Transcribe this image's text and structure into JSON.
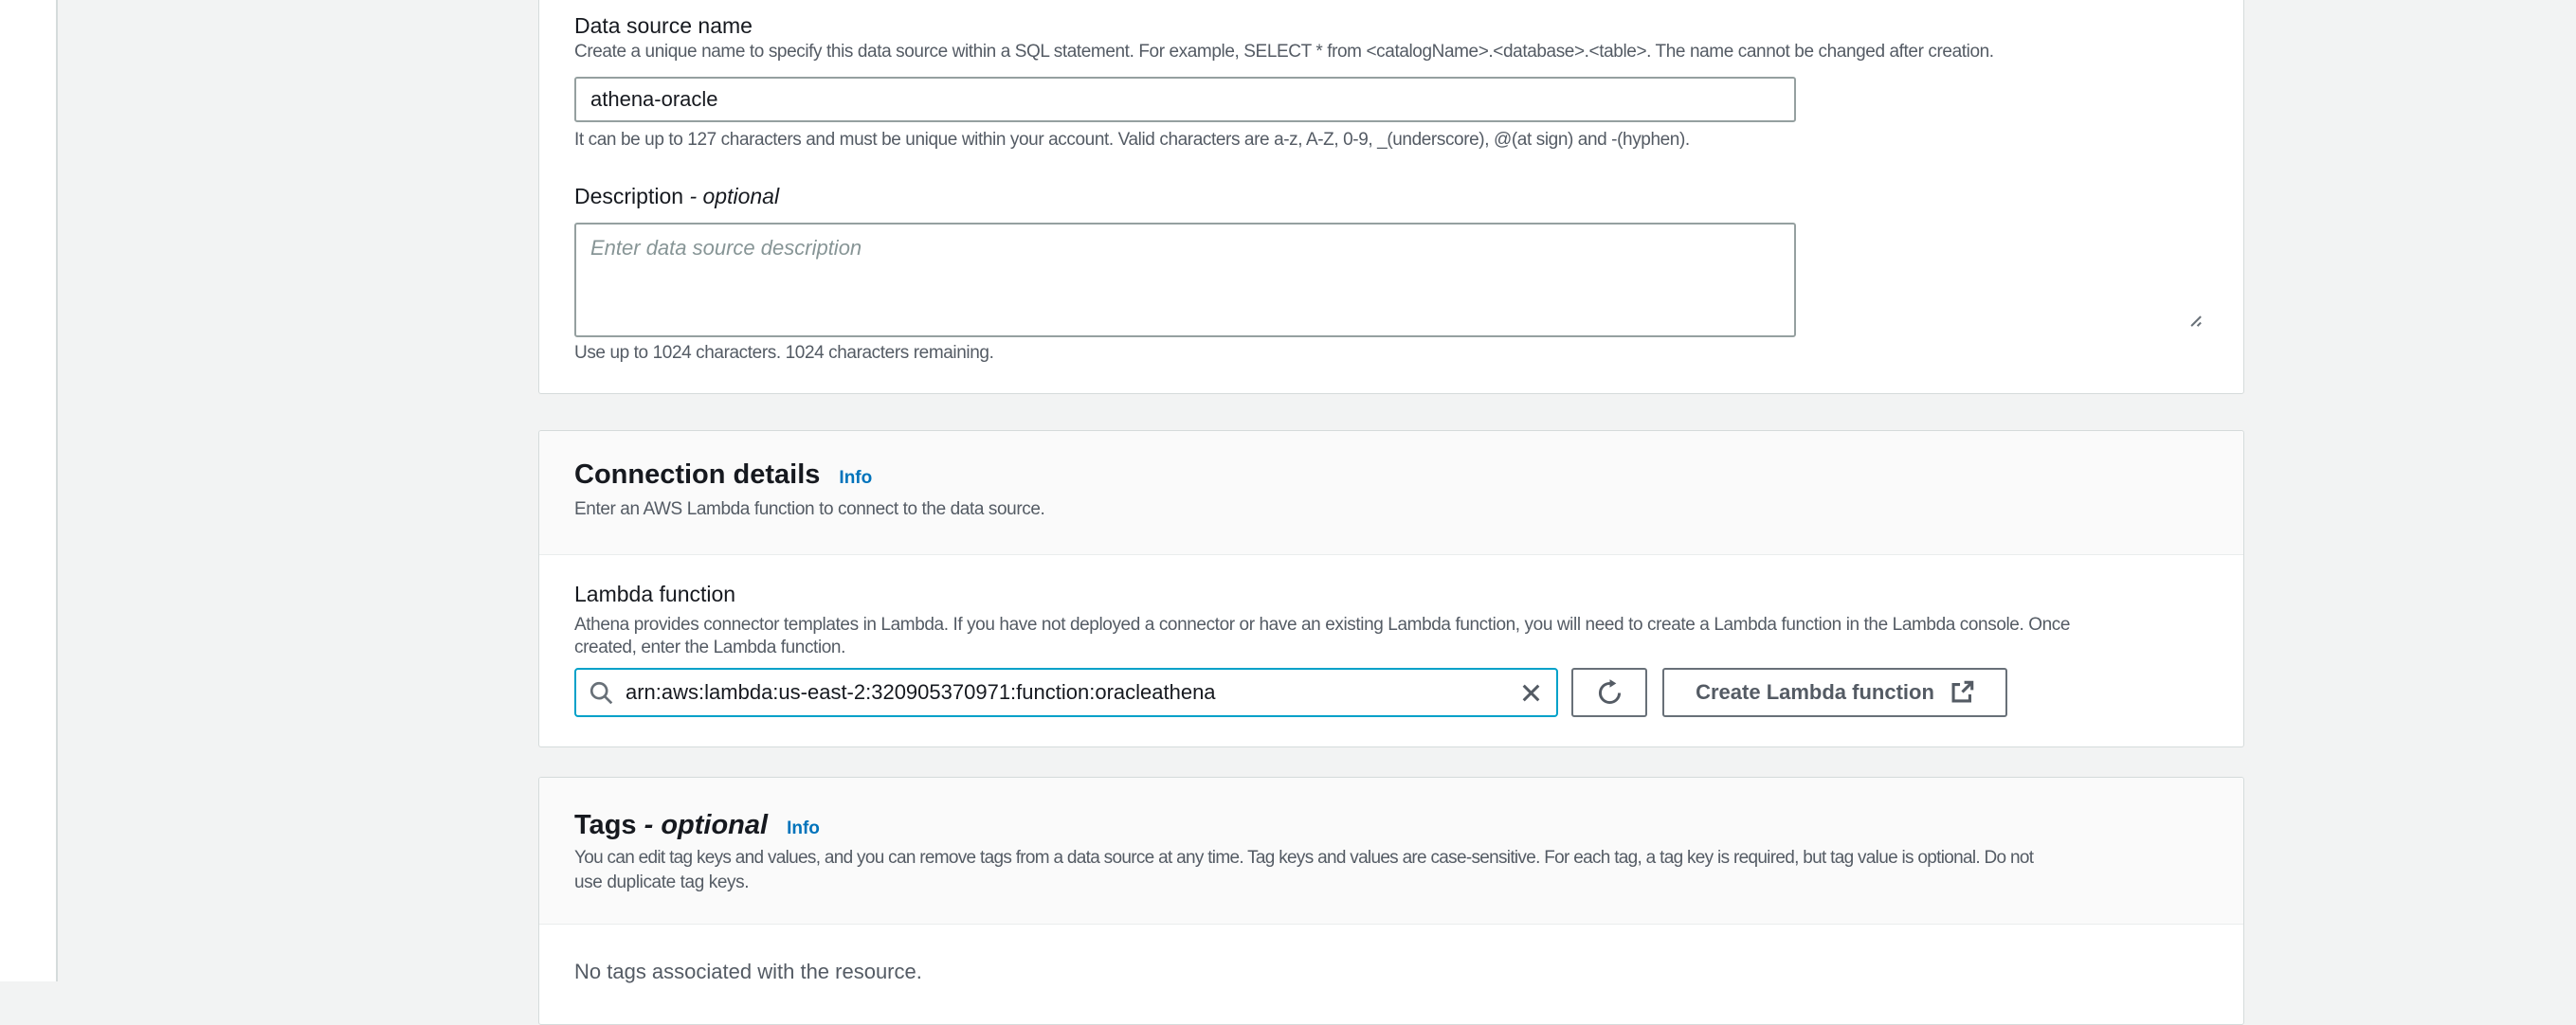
{
  "colors": {
    "page_background": "#f2f3f3",
    "card_background": "#ffffff",
    "card_border": "#d5dbdb",
    "card_header_background": "#fafafa",
    "divider": "#eaeded",
    "text_primary": "#16191f",
    "text_secondary": "#545b64",
    "link_blue": "#0073bb",
    "input_border": "#95a0a0",
    "focused_input_border": "#00a1c9",
    "button_border": "#687078",
    "spellcheck_underline": "#ef7c68",
    "placeholder_text": "#879596"
  },
  "icons": {
    "search": "search-icon",
    "clear": "close-icon",
    "refresh": "refresh-icon",
    "external": "external-link-icon",
    "resize": "resize-corner-icon"
  },
  "data_source_card": {
    "name_field": {
      "label": "Data source name",
      "description": "Create a unique name to specify this data source within a SQL statement. For example, SELECT * from <catalogName>.<database>.<table>. The name cannot be changed after creation.",
      "value": "athena-oracle",
      "hint": "It can be up to 127 characters and must be unique within your account. Valid characters are a-z, A-Z, 0-9, _(underscore), @(at sign) and -(hyphen)."
    },
    "description_field": {
      "label": "Description",
      "label_optional": "- optional",
      "placeholder": "Enter data source description",
      "hint": "Use up to 1024 characters. 1024 characters remaining."
    }
  },
  "connection_card": {
    "title": "Connection details",
    "info_label": "Info",
    "description": "Enter an AWS Lambda function to connect to the data source.",
    "lambda_field": {
      "label": "Lambda function",
      "description_line1": "Athena provides connector templates in Lambda. If you have not deployed a connector or have an existing Lambda function, you will need to create a Lambda function in the Lambda console. Once",
      "description_line2": "created, enter the Lambda function.",
      "search_value": "arn:aws:lambda:us-east-2:320905370971:function:oracleathena",
      "create_button_label": "Create Lambda function"
    }
  },
  "tags_card": {
    "title": "Tags",
    "title_optional": "- optional",
    "info_label": "Info",
    "description_line1": "You can edit tag keys and values, and you can remove tags from a data source at any time. Tag keys and values are case-sensitive. For each tag, a tag key is required, but tag value is optional. Do not",
    "description_line2": "use duplicate tag keys.",
    "empty_text": "No tags associated with the resource."
  }
}
